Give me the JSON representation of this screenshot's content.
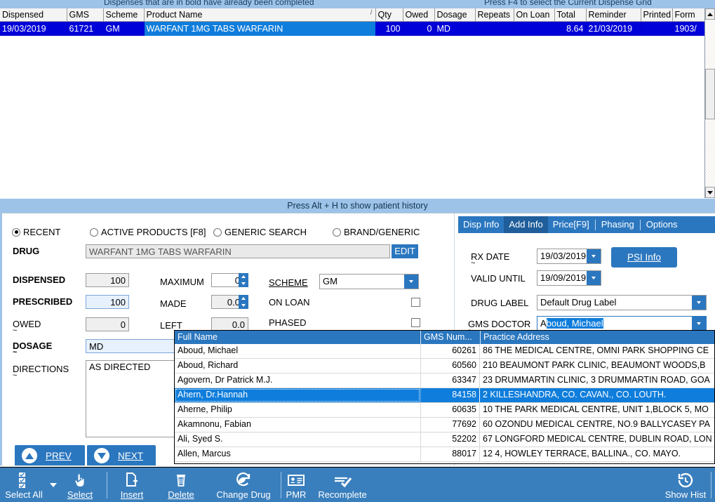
{
  "banner": {
    "left_hint": "Dispenses that are in bold have already been completed",
    "right_hint": "Press F4 to select the Current Dispense Grid"
  },
  "grid": {
    "columns": [
      "Dispensed",
      "GMS",
      "Scheme",
      "Product Name",
      "Qty",
      "Owed",
      "Dosage",
      "Repeats",
      "On Loan",
      "Total",
      "Reminder",
      "Printed",
      "Form"
    ],
    "sort_indicator": "/",
    "rows": [
      {
        "dispensed": "19/03/2019",
        "gms": "61721",
        "scheme": "GM",
        "product_name": "WARFANT 1MG TABS WARFARIN",
        "qty": "100",
        "owed": "0",
        "dosage": "MD",
        "repeats": "",
        "on_loan": "",
        "total": "8.64",
        "reminder": "21/03/2019",
        "printed": "",
        "form": "1903/"
      }
    ]
  },
  "hint_bar": {
    "text": "Press Alt + H to show patient history"
  },
  "search_modes": [
    {
      "label": "RECENT",
      "selected": true
    },
    {
      "label": "ACTIVE PRODUCTS [F8]",
      "selected": false
    },
    {
      "label": "GENERIC SEARCH",
      "selected": false
    },
    {
      "label": "BRAND/GENERIC",
      "selected": false
    }
  ],
  "form": {
    "drug_label": "DRUG",
    "drug_value": "WARFANT 1MG TABS WARFARIN",
    "edit_button": "EDIT",
    "dispensed_label": "DISPENSED",
    "dispensed_value": "100",
    "prescribed_label": "PRESCRIBED",
    "prescribed_value": "100",
    "owed_label": "OWED",
    "owed_value": "0",
    "maximum_label": "MAXIMUM",
    "maximum_value": "0",
    "made_label": "MADE",
    "made_value": "0.0",
    "left_label": "LEFT",
    "left_value": "0.0",
    "scheme_label": "SCHEME",
    "scheme_value": "GM",
    "on_loan_label": "ON LOAN",
    "on_loan_checked": false,
    "phased_label": "PHASED",
    "phased_checked": false,
    "dosage_label": "DOSAGE",
    "dosage_value": "MD",
    "directions_label": "DIRECTIONS",
    "directions_value": "AS DIRECTED",
    "prev_button": "PREV",
    "next_button": "NEXT"
  },
  "right_panel": {
    "tabs": [
      {
        "label": "Disp Info",
        "active": false
      },
      {
        "label": "Add Info",
        "active": true
      },
      {
        "label": "Price[F9]",
        "active": false
      },
      {
        "label": "Phasing",
        "active": false
      },
      {
        "label": "Options",
        "active": false
      }
    ],
    "rx_date_label": "RX DATE",
    "rx_date_value": "19/03/2019",
    "valid_until_label": "VALID UNTIL",
    "valid_until_value": "19/09/2019",
    "psi_button": "PSI Info",
    "drug_label_label": "DRUG LABEL",
    "drug_label_value": "Default Drug Label",
    "gms_doctor_label": "GMS DOCTOR",
    "gms_doctor_typed": "A",
    "gms_doctor_completion": "boud, Michael"
  },
  "doctor_dropdown": {
    "columns": [
      "Full Name",
      "GMS Num...",
      "Practice Address"
    ],
    "rows": [
      {
        "name": "Aboud, Michael",
        "gms": "60261",
        "address": "86 THE MEDICAL CENTRE, OMNI PARK SHOPPING CE",
        "selected": false
      },
      {
        "name": "Aboud, Richard",
        "gms": "60560",
        "address": "210 BEAUMONT PARK CLINIC, BEAUMONT WOODS,B",
        "selected": false
      },
      {
        "name": "Agovern, Dr Patrick M.J.",
        "gms": "63347",
        "address": "23 DRUMMARTIN CLINIC, 3 DRUMMARTIN ROAD, GOA",
        "selected": false
      },
      {
        "name": "Ahern, Dr.Hannah",
        "gms": "84158",
        "address": "2 KILLESHANDRA, CO. CAVAN., CO. LOUTH.",
        "selected": true
      },
      {
        "name": "Aherne, Philip",
        "gms": "60635",
        "address": "10 THE PARK MEDICAL CENTRE, UNIT 1,BLOCK 5, MO",
        "selected": false
      },
      {
        "name": "Akamnonu, Fabian",
        "gms": "77692",
        "address": "60 OZONDU MEDICAL CENTRE, NO.9 BALLYCASEY PA",
        "selected": false
      },
      {
        "name": "Ali, Syed S.",
        "gms": "52202",
        "address": "67 LONGFORD MEDICAL CENTRE, DUBLIN ROAD, LON",
        "selected": false
      },
      {
        "name": "Allen, Marcus",
        "gms": "88017",
        "address": "12 4, HOWLEY TERRACE, BALLINA., CO. MAYO.",
        "selected": false
      }
    ]
  },
  "toolbar": {
    "items": [
      {
        "label": "Select All",
        "icon": "checklist-icon"
      },
      {
        "label": "Select",
        "icon": "hand-pointer-icon"
      },
      {
        "label": "Insert",
        "icon": "page-plus-icon"
      },
      {
        "label": "Delete",
        "icon": "trash-icon"
      },
      {
        "label": "Change Drug",
        "icon": "pill-swap-icon"
      },
      {
        "label": "PMR",
        "icon": "id-card-icon"
      },
      {
        "label": "Recomplete",
        "icon": "check-stack-icon"
      },
      {
        "label": "Show Hist",
        "icon": "history-clock-icon"
      }
    ]
  },
  "colors": {
    "accent": "#2b77bf",
    "banner": "#9dc3e9",
    "row_select": "#0000d8",
    "cell_focus": "#0f7ddb",
    "toolbar": "#3a7fbd"
  }
}
